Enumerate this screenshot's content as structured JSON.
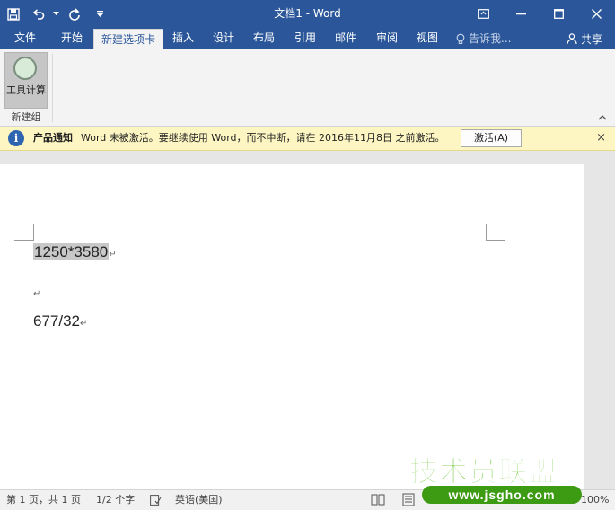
{
  "window": {
    "title": "文档1 - Word"
  },
  "tabs": [
    {
      "label": "文件"
    },
    {
      "label": "开始"
    },
    {
      "label": "新建选项卡",
      "active": true
    },
    {
      "label": "插入"
    },
    {
      "label": "设计"
    },
    {
      "label": "布局"
    },
    {
      "label": "引用"
    },
    {
      "label": "邮件"
    },
    {
      "label": "审阅"
    },
    {
      "label": "视图"
    }
  ],
  "tell_me": {
    "placeholder": "告诉我..."
  },
  "share": {
    "label": "共享"
  },
  "ribbon": {
    "button_label": "工具计算",
    "group_label": "新建组"
  },
  "notification": {
    "title": "产品通知",
    "message": "Word 未被激活。要继续使用 Word，而不中断，请在 2016年11月8日 之前激活。",
    "activate_label": "激活(A)",
    "close": "×"
  },
  "document": {
    "lines": [
      {
        "text": "1250*3580",
        "selected": true
      },
      {
        "text": "",
        "selected": false
      },
      {
        "text": "677/32",
        "selected": false
      }
    ],
    "paragraph_mark": "↵"
  },
  "status": {
    "page": "第 1 页，共 1 页",
    "words": "1/2 个字",
    "language": "英语(美国)",
    "zoom": "100%"
  },
  "watermark": {
    "title": "技术员联盟",
    "url": "www.jsgho.com"
  },
  "colors": {
    "titlebar": "#2b579a",
    "ribbon": "#f3f3f3",
    "notify": "#fdf6c3",
    "watermark_green": "#5bbf1d"
  }
}
